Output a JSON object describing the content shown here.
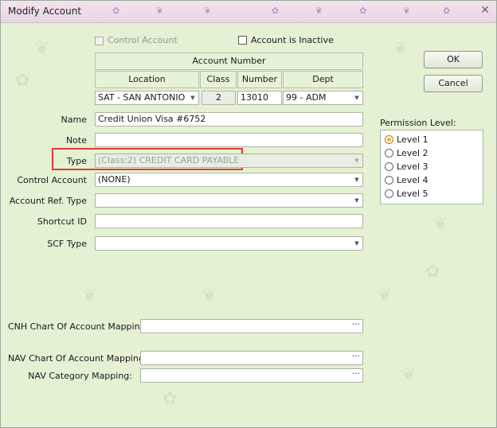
{
  "window": {
    "title": "Modify Account",
    "close_glyph": "✕"
  },
  "checkboxes": {
    "control_account": "Control Account",
    "account_inactive": "Account is Inactive"
  },
  "account_number": {
    "header": "Account Number",
    "columns": {
      "location": "Location",
      "class": "Class",
      "number": "Number",
      "dept": "Dept"
    },
    "values": {
      "location": "SAT - SAN ANTONIO",
      "class": "2",
      "number": "13010",
      "dept": "99 - ADM"
    }
  },
  "form": {
    "name_label": "Name",
    "name_value": "Credit Union Visa #6752",
    "note_label": "Note",
    "note_value": "",
    "type_label": "Type",
    "type_value": "(Class:2) CREDIT CARD PAYABLE",
    "control_account_label": "Control Account",
    "control_account_value": "(NONE)",
    "account_ref_type_label": "Account Ref. Type",
    "account_ref_type_value": "",
    "shortcut_id_label": "Shortcut ID",
    "shortcut_id_value": "",
    "scf_type_label": "SCF Type",
    "scf_type_value": ""
  },
  "mappings": {
    "cnh_label": "CNH Chart Of Account Mapping:",
    "cnh_value": "",
    "nav_label": "NAV Chart Of Account Mapping:",
    "nav_value": "",
    "nav_category_label": "NAV Category Mapping:",
    "nav_category_value": "",
    "ellipsis": "···"
  },
  "buttons": {
    "ok": "OK",
    "cancel": "Cancel"
  },
  "permission": {
    "label": "Permission Level:",
    "levels": [
      "Level 1",
      "Level 2",
      "Level 3",
      "Level 4",
      "Level 5"
    ],
    "selected": "Level 1"
  },
  "glyphs": {
    "dropdown": "▼"
  },
  "colors": {
    "highlight": "#e03a3a",
    "background": "#e4f1d3"
  }
}
